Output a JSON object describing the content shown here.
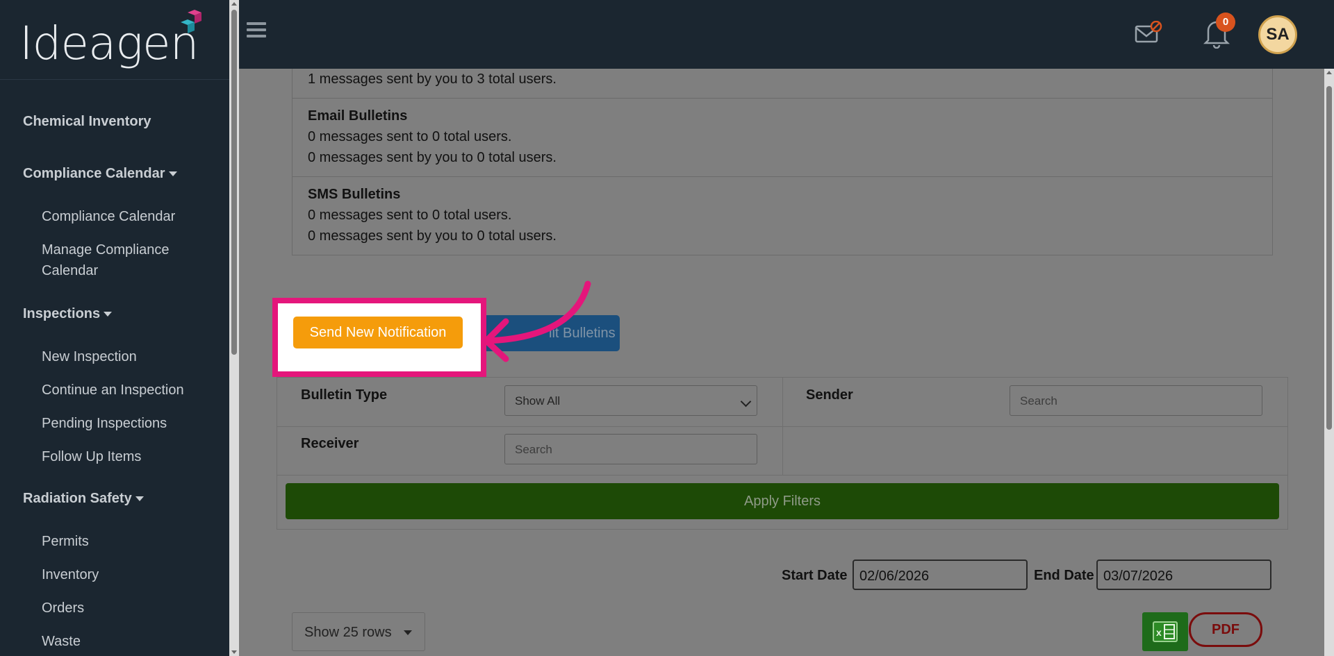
{
  "brand": {
    "logo_text": "Ideagen"
  },
  "sidebar": {
    "sections": [
      {
        "label": "Chemical Inventory"
      },
      {
        "label": "Compliance Calendar",
        "items": [
          "Compliance Calendar",
          "Manage Compliance",
          "Calendar"
        ]
      },
      {
        "label": "Inspections",
        "items": [
          "New Inspection",
          "Continue an Inspection",
          "Pending Inspections",
          "Follow Up Items"
        ]
      },
      {
        "label": "Radiation Safety",
        "items": [
          "Permits",
          "Inventory",
          "Orders",
          "Waste"
        ]
      }
    ]
  },
  "topbar": {
    "notification_count": "0",
    "avatar_initials": "SA",
    "icons": [
      "hamburger-icon",
      "mail-blocked-icon",
      "bell-icon"
    ]
  },
  "stats": {
    "partial_line": "1 messages sent by you to 3 total users.",
    "email": {
      "title": "Email Bulletins",
      "line1": "0 messages sent to 0 total users.",
      "line2": "0 messages sent by you to 0 total users."
    },
    "sms": {
      "title": "SMS Bulletins",
      "line1": "0 messages sent to 0 total users.",
      "line2": "0 messages sent by you to 0 total users."
    }
  },
  "actions": {
    "send_label": "Send New Notification",
    "edit_label": "lit Bulletins"
  },
  "filters": {
    "bulletin_type_label": "Bulletin Type",
    "bulletin_type_value": "Show All",
    "sender_label": "Sender",
    "sender_placeholder": "Search",
    "receiver_label": "Receiver",
    "receiver_placeholder": "Search",
    "apply_label": "Apply Filters"
  },
  "dates": {
    "start_label": "Start Date",
    "start_value": "02/06/2026",
    "end_label": "End Date",
    "end_value": "03/07/2026"
  },
  "table": {
    "rows_label": "Show 25 rows",
    "pdf_label": "PDF"
  },
  "colors": {
    "highlight": "#e4167b",
    "send_button": "#f59c0b",
    "apply_button": "#1d4a06",
    "sidebar": "#1b2630"
  }
}
